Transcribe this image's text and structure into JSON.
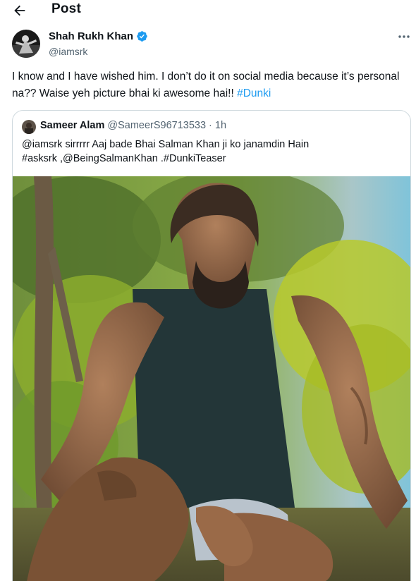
{
  "header": {
    "title": "Post",
    "back_icon": "arrow-left-icon"
  },
  "author": {
    "name": "Shah Rukh Khan",
    "handle": "@iamsrk",
    "verified": true,
    "verified_color": "#1d9bf0"
  },
  "tweet": {
    "text": "I know and I have wished him. I don’t do it on social media because it’s personal na?? Waise yeh picture bhai ki awesome hai!! ",
    "hashtag": "#Dunki"
  },
  "quote": {
    "name": "Sameer Alam",
    "handle": "@SameerS96713533",
    "separator": "·",
    "time": "1h",
    "line1": "@iamsrk sirrrrr Aaj bade Bhai Salman Khan ji ko janamdin Hain",
    "line2": "#asksrk ,@BeingSalmanKhan .#DunkiTeaser"
  },
  "colors": {
    "link": "#1d9bf0",
    "secondary_text": "#536471",
    "border": "#cfd9de"
  }
}
